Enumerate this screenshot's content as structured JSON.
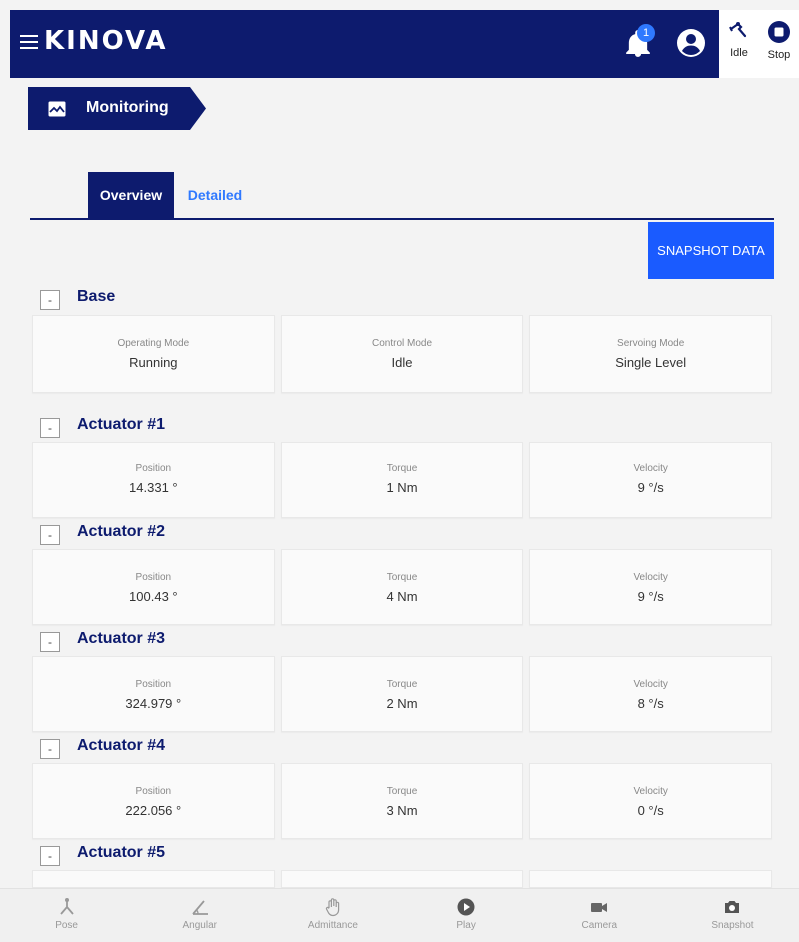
{
  "header": {
    "logo_text": "KINOVA",
    "notification_count": "1",
    "robot_status_label": "Idle",
    "stop_label": "Stop"
  },
  "breadcrumb": {
    "label": "Monitoring"
  },
  "tabs": [
    {
      "label": "Overview",
      "active": true
    },
    {
      "label": "Detailed",
      "active": false
    }
  ],
  "snapshot_button": "SNAPSHOT DATA",
  "sections": {
    "base": {
      "title": "Base",
      "collapse_symbol": "-",
      "fields": [
        {
          "label": "Operating Mode",
          "value": "Running"
        },
        {
          "label": "Control Mode",
          "value": "Idle"
        },
        {
          "label": "Servoing Mode",
          "value": "Single Level"
        }
      ]
    },
    "actuator1": {
      "title": "Actuator #1",
      "collapse_symbol": "-",
      "fields": [
        {
          "label": "Position",
          "value": "14.331 °"
        },
        {
          "label": "Torque",
          "value": "1 Nm"
        },
        {
          "label": "Velocity",
          "value": "9 °/s"
        }
      ]
    },
    "actuator2": {
      "title": "Actuator #2",
      "collapse_symbol": "-",
      "fields": [
        {
          "label": "Position",
          "value": "100.43 °"
        },
        {
          "label": "Torque",
          "value": "4 Nm"
        },
        {
          "label": "Velocity",
          "value": "9 °/s"
        }
      ]
    },
    "actuator3": {
      "title": "Actuator #3",
      "collapse_symbol": "-",
      "fields": [
        {
          "label": "Position",
          "value": "324.979 °"
        },
        {
          "label": "Torque",
          "value": "2 Nm"
        },
        {
          "label": "Velocity",
          "value": "8 °/s"
        }
      ]
    },
    "actuator4": {
      "title": "Actuator #4",
      "collapse_symbol": "-",
      "fields": [
        {
          "label": "Position",
          "value": "222.056 °"
        },
        {
          "label": "Torque",
          "value": "3 Nm"
        },
        {
          "label": "Velocity",
          "value": "0 °/s"
        }
      ]
    },
    "actuator5": {
      "title": "Actuator #5",
      "collapse_symbol": "-"
    }
  },
  "bottom_nav": [
    {
      "label": "Pose",
      "icon": "pose-icon"
    },
    {
      "label": "Angular",
      "icon": "angular-icon"
    },
    {
      "label": "Admittance",
      "icon": "hand-icon"
    },
    {
      "label": "Play",
      "icon": "play-icon"
    },
    {
      "label": "Camera",
      "icon": "camera-icon"
    },
    {
      "label": "Snapshot",
      "icon": "snapshot-icon"
    }
  ],
  "colors": {
    "header_bg": "#0d1b6e",
    "accent_blue": "#1a5bff",
    "tab_inactive": "#2f79ff",
    "page_bg": "#f3f3f3"
  }
}
